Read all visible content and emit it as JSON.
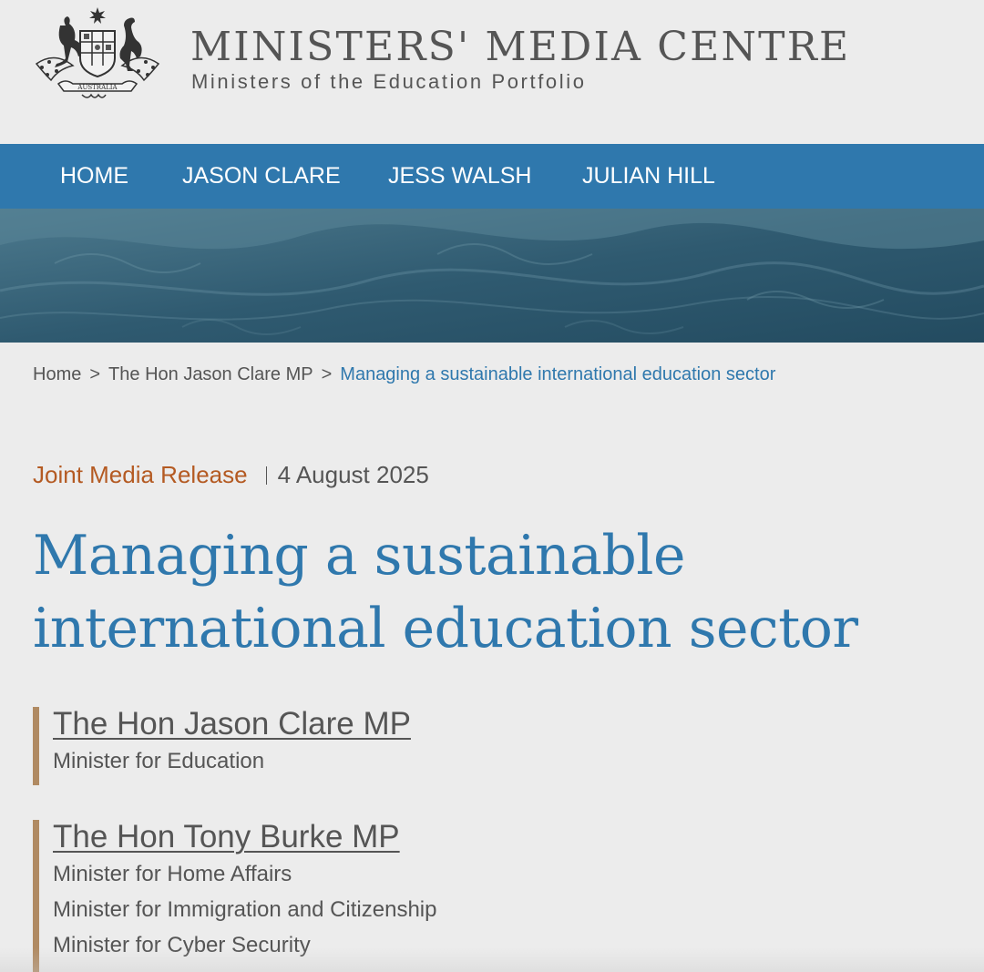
{
  "header": {
    "site_title": "MINISTERS' MEDIA CENTRE",
    "site_subtitle": "Ministers of the Education Portfolio",
    "crest_label": "AUSTRALIA"
  },
  "nav": {
    "items": [
      {
        "label": "HOME"
      },
      {
        "label": "JASON CLARE"
      },
      {
        "label": "JESS WALSH"
      },
      {
        "label": "JULIAN HILL"
      }
    ]
  },
  "breadcrumb": {
    "items": [
      "Home",
      "The Hon Jason Clare MP"
    ],
    "current": "Managing a sustainable international education sector",
    "separator": ">"
  },
  "release": {
    "type": "Joint Media Release",
    "date": "4 August 2025"
  },
  "article": {
    "title": "Managing a sustainable international education sector"
  },
  "ministers": [
    {
      "name": "The Hon Jason Clare MP",
      "roles": [
        "Minister for Education"
      ]
    },
    {
      "name": "The Hon Tony Burke MP",
      "roles": [
        "Minister for Home Affairs",
        "Minister for Immigration and Citizenship",
        "Minister for Cyber Security"
      ]
    }
  ],
  "colors": {
    "nav_blue": "#2f78ad",
    "title_blue": "#2f78ad",
    "release_orange": "#b45a22",
    "minister_bar": "#b08a62",
    "background": "#ececec"
  }
}
